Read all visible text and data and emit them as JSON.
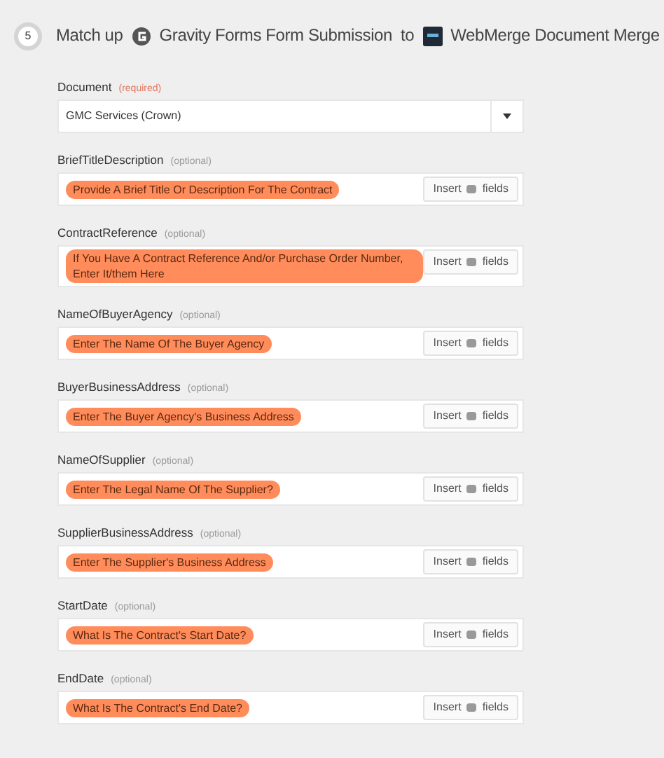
{
  "header": {
    "step": "5",
    "lead": "Match up",
    "source_app": "Gravity Forms Form Submission",
    "connector": "to",
    "target_app": "WebMerge Document Merge"
  },
  "document": {
    "label": "Document",
    "tag": "(required)",
    "required": true,
    "value": "GMC Services (Crown)"
  },
  "fields": [
    {
      "label": "BriefTitleDescription",
      "tag": "(optional)",
      "required": false,
      "value": "Provide A Brief Title Or Description For The Contract",
      "insert": [
        "Insert",
        "fields"
      ]
    },
    {
      "label": "ContractReference",
      "tag": "(optional)",
      "required": false,
      "value": "If You Have A Contract Reference And/or Purchase Order Number, Enter It/them Here",
      "insert": [
        "Insert",
        "fields"
      ]
    },
    {
      "label": "NameOfBuyerAgency",
      "tag": "(optional)",
      "required": false,
      "value": "Enter The Name Of The Buyer Agency",
      "insert": [
        "Insert",
        "fields"
      ]
    },
    {
      "label": "BuyerBusinessAddress",
      "tag": "(optional)",
      "required": false,
      "value": "Enter The Buyer Agency's Business Address",
      "insert": [
        "Insert",
        "fields"
      ]
    },
    {
      "label": "NameOfSupplier",
      "tag": "(optional)",
      "required": false,
      "value": "Enter The Legal Name Of The Supplier?",
      "insert": [
        "Insert",
        "fields"
      ]
    },
    {
      "label": "SupplierBusinessAddress",
      "tag": "(optional)",
      "required": false,
      "value": "Enter The Supplier's Business Address",
      "insert": [
        "Insert",
        "fields"
      ]
    },
    {
      "label": "StartDate",
      "tag": "(optional)",
      "required": false,
      "value": "What Is The Contract's Start Date?",
      "insert": [
        "Insert",
        "fields"
      ]
    },
    {
      "label": "EndDate",
      "tag": "(optional)",
      "required": false,
      "value": "What Is The Contract's End Date?",
      "insert": [
        "Insert",
        "fields"
      ]
    }
  ]
}
